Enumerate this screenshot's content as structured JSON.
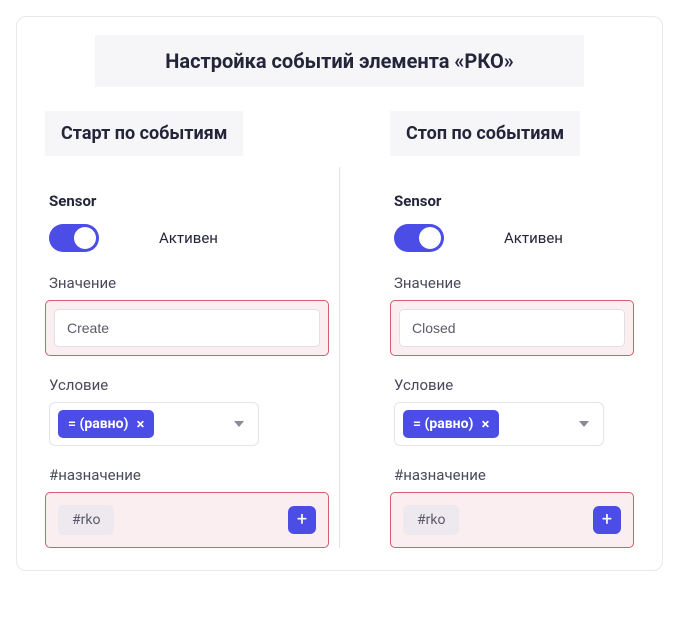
{
  "title": "Настройка событий элемента «РКО»",
  "columns": {
    "start": {
      "heading": "Старт по событиям",
      "sensor_label": "Sensor",
      "active_text": "Активен",
      "value_label": "Значение",
      "value": "Create",
      "condition_label": "Условие",
      "condition_chip": "= (равно)",
      "purpose_label": "#назначение",
      "tag": "#rko"
    },
    "stop": {
      "heading": "Стоп по событиям",
      "sensor_label": "Sensor",
      "active_text": "Активен",
      "value_label": "Значение",
      "value": "Closed",
      "condition_label": "Условие",
      "condition_chip": "= (равно)",
      "purpose_label": "#назначение",
      "tag": "#rko"
    }
  },
  "icons": {
    "close": "×",
    "plus": "+"
  }
}
